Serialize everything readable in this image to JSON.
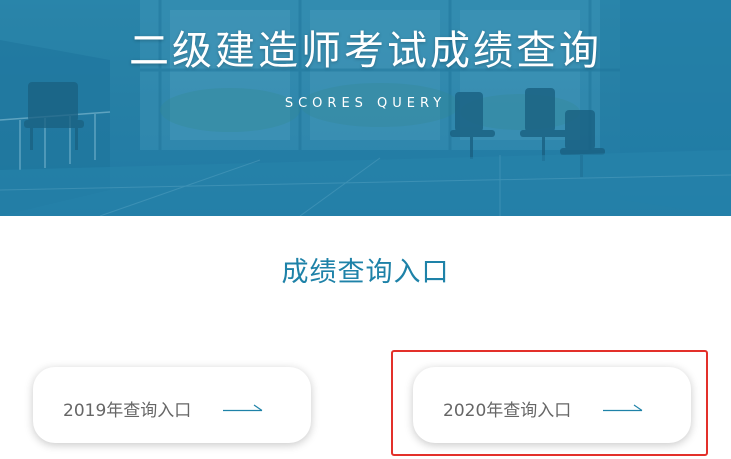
{
  "banner": {
    "title": "二级建造师考试成绩查询",
    "subtitle": "SCORES QUERY"
  },
  "section": {
    "title": "成绩查询入口"
  },
  "cards": [
    {
      "label": "2019年查询入口",
      "icon": "arrow-right-icon"
    },
    {
      "label": "2020年查询入口",
      "icon": "arrow-right-icon"
    }
  ],
  "colors": {
    "banner_bg": "#2a7fa2",
    "accent": "#1e82a8",
    "card_text": "#666666",
    "highlight": "#e3302a"
  }
}
